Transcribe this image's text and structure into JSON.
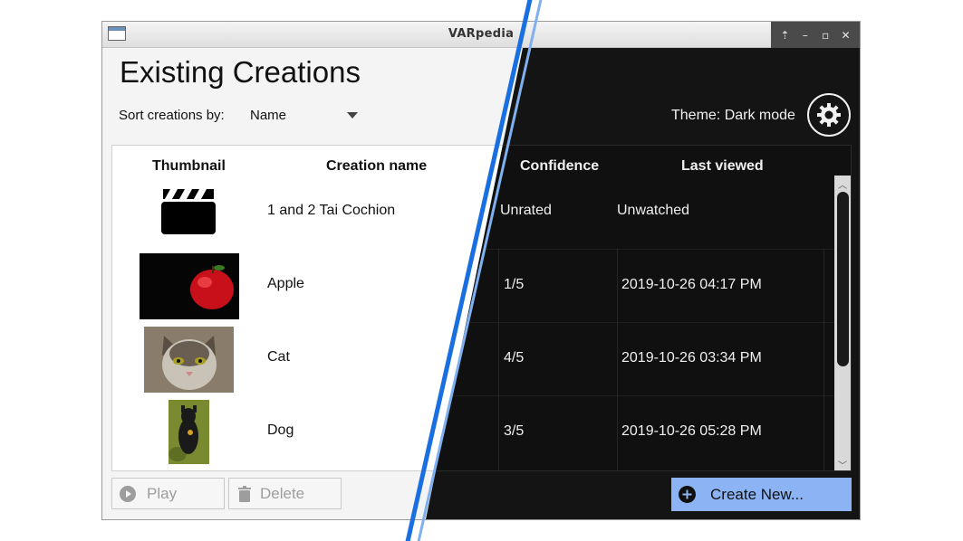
{
  "window": {
    "title": "VARpedia",
    "controls": [
      "⇡",
      "–",
      "▫",
      "✕"
    ]
  },
  "header": {
    "title": "Existing Creations"
  },
  "sort": {
    "label": "Sort creations by:",
    "value": "Name"
  },
  "theme": {
    "label": "Theme: Dark mode"
  },
  "table": {
    "columns": [
      "Thumbnail",
      "Creation name",
      "Confidence",
      "Last viewed"
    ],
    "rows": [
      {
        "thumbnail": "clapperboard-icon",
        "name": "1 and 2 Tai Cochion",
        "confidence": "Unrated",
        "last_viewed": "Unwatched"
      },
      {
        "thumbnail": "apple-image",
        "name": "Apple",
        "confidence": "1/5",
        "last_viewed": "2019-10-26 04:17 PM"
      },
      {
        "thumbnail": "cat-image",
        "name": "Cat",
        "confidence": "4/5",
        "last_viewed": "2019-10-26 03:34 PM"
      },
      {
        "thumbnail": "dog-image",
        "name": "Dog",
        "confidence": "3/5",
        "last_viewed": "2019-10-26 05:28 PM"
      }
    ]
  },
  "buttons": {
    "play": "Play",
    "delete": "Delete",
    "create": "Create New..."
  },
  "colors": {
    "accent": "#8cb4f4",
    "divider": "#1a6fe0",
    "divider_light": "#7fb0f0",
    "dark_bg": "#141414"
  }
}
